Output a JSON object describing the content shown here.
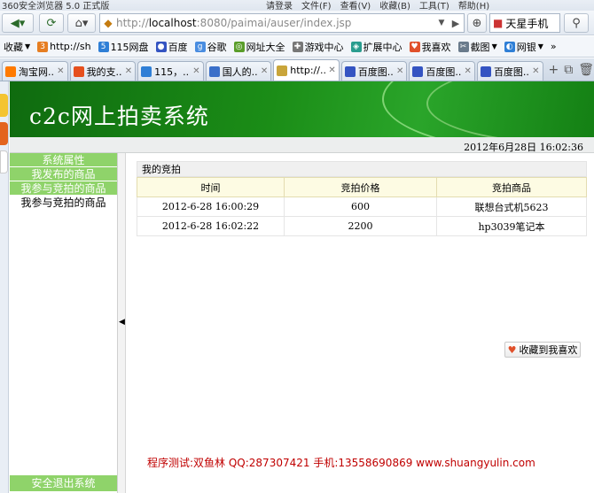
{
  "browser": {
    "window_title": "360安全浏览器 5.0 正式版",
    "login_label": "请登录",
    "menu": [
      "文件(F)",
      "查看(V)",
      "收藏(B)",
      "工具(T)",
      "帮助(H)"
    ],
    "address_prefix": "http://",
    "address_host": "localhost",
    "address_rest": ":8080/paimai/auser/index.jsp",
    "search_label": "天星手机",
    "favorites_label": "收藏",
    "bookmarks": [
      "http://sh",
      "115网盘",
      "百度",
      "谷歌",
      "网址大全",
      "游戏中心",
      "扩展中心",
      "我喜欢",
      "截图",
      "网银"
    ],
    "tabs": [
      {
        "label": "淘宝网...",
        "color": "#ff7a00"
      },
      {
        "label": "我的支...",
        "color": "#e6501e"
      },
      {
        "label": "115，...",
        "color": "#2f7fd6"
      },
      {
        "label": "国人的...",
        "color": "#3a6fc9"
      },
      {
        "label": "http://...",
        "color": "#c9a53a"
      },
      {
        "label": "百度图...",
        "color": "#3454c2"
      },
      {
        "label": "百度图...",
        "color": "#3454c2"
      },
      {
        "label": "百度图...",
        "color": "#3454c2"
      }
    ]
  },
  "site": {
    "banner_title": "c2c网上拍卖系统",
    "datetime": "2012年6月28日  16:02:36"
  },
  "sidebar": {
    "items": [
      {
        "label": "系统属性",
        "style": "g"
      },
      {
        "label": "我发布的商品",
        "style": "g"
      },
      {
        "label": "我参与竞拍的商品",
        "style": "g"
      },
      {
        "label": "我参与竞拍的商品",
        "style": "w"
      }
    ],
    "exit_label": "安全退出系统"
  },
  "auction": {
    "panel_title": "我的竞拍",
    "columns": [
      "时间",
      "竞拍价格",
      "竞拍商品"
    ],
    "rows": [
      [
        "2012-6-28 16:00:29",
        "600",
        "联想台式机5623"
      ],
      [
        "2012-6-28 16:02:22",
        "2200",
        "hp3039笔记本"
      ]
    ]
  },
  "favorite_button": "收藏到我喜欢",
  "footer": "程序测试:双鱼林 QQ:287307421 手机:13558690869 www.shuangyulin.com"
}
